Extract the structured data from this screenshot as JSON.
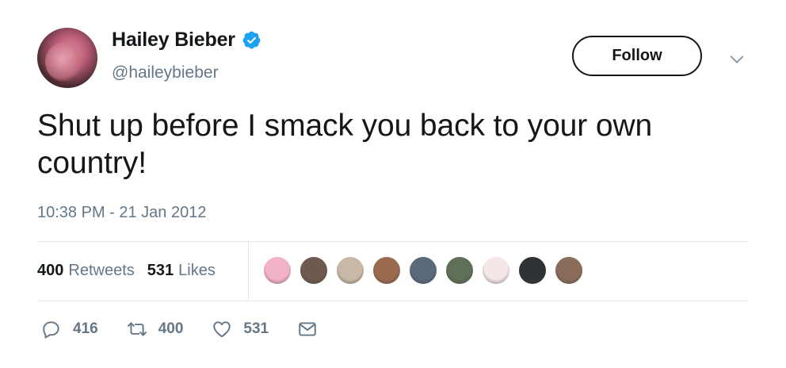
{
  "author": {
    "display_name": "Hailey Bieber",
    "handle": "@haileybieber",
    "verified": true,
    "verified_color": "#1da1f2"
  },
  "follow_button": {
    "label": "Follow"
  },
  "tweet": {
    "text": "Shut up before I smack you back to your own country!",
    "timestamp": "10:38 PM - 21 Jan 2012"
  },
  "stats": {
    "retweets_count": "400",
    "retweets_label": "Retweets",
    "likes_count": "531",
    "likes_label": "Likes"
  },
  "likers": [
    {
      "color": "#f2b3c6"
    },
    {
      "color": "#6e5a4e"
    },
    {
      "color": "#c9b8a6"
    },
    {
      "color": "#9a6b4f"
    },
    {
      "color": "#5b6a7a"
    },
    {
      "color": "#5f6f58"
    },
    {
      "color": "#f5e6e8"
    },
    {
      "color": "#2f3338"
    },
    {
      "color": "#8a6c5a"
    }
  ],
  "actions": {
    "reply_count": "416",
    "retweet_count": "400",
    "like_count": "531"
  },
  "colors": {
    "text": "#14171a",
    "secondary": "#657786",
    "divider": "#e1e8ed"
  }
}
